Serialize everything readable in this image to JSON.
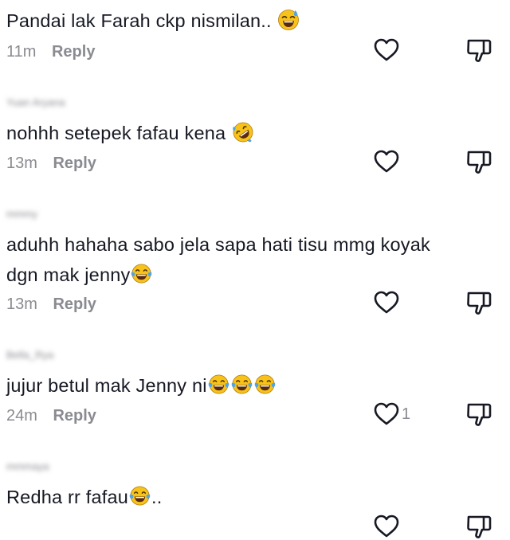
{
  "comments": [
    {
      "username": "",
      "text": "Pandai lak Farah ckp nismilan..",
      "emoji": "sweat-smile-emoji",
      "time": "11m",
      "reply_label": "Reply",
      "like_count": ""
    },
    {
      "username": "Yuan Aryana",
      "text": "nohhh setepek fafau kena",
      "emoji": "rolling-laughing-emoji",
      "time": "13m",
      "reply_label": "Reply",
      "like_count": ""
    },
    {
      "username": "mmmy",
      "text_line1": "aduhh hahaha sabo jela sapa hati tisu mmg koyak",
      "text_line2": "dgn mak jenny",
      "emoji": "tears-of-joy-emoji",
      "time": "13m",
      "reply_label": "Reply",
      "like_count": ""
    },
    {
      "username": "Bella_Rya",
      "text": "jujur betul mak Jenny ni",
      "emoji": "tears-of-joy-emoji",
      "time": "24m",
      "reply_label": "Reply",
      "like_count": "1"
    },
    {
      "username": "mmmaya",
      "text": "Redha rr fafau",
      "text_suffix": "..",
      "emoji": "tears-of-joy-emoji"
    }
  ],
  "colors": {
    "text": "#161823",
    "secondary": "#8a8b91",
    "icon": "#161823",
    "emoji_face": "#f7c31b",
    "emoji_tear": "#4fa3e8"
  }
}
